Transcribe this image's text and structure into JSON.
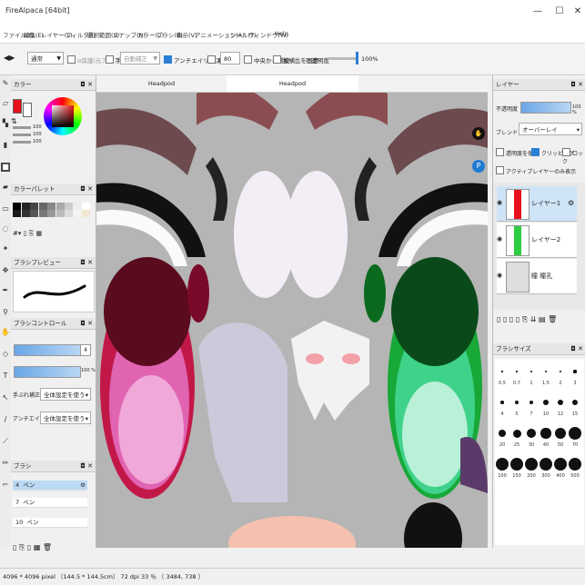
{
  "window": {
    "title": "FireAlpaca [64bit]",
    "minimize": "—",
    "maximize": "☐",
    "close": "✕"
  },
  "menu": [
    "ファイル(F)",
    "編集(E)",
    "レイヤー(L)",
    "フィルタ(I)",
    "選択範囲(S)",
    "スナップ(N)",
    "カラー(C)",
    "ブラシ(B)",
    "表示(V)",
    "アニメーション(A)",
    "ツール(T)",
    "ウィンドウ(W)",
    "Help"
  ],
  "tooloptions": {
    "mode_value": "通常",
    "protect_alpha": "α保護(元アルファ)",
    "hand_correction_label": "手ぶれ",
    "hand_correction_value": "自動補正",
    "antialias": "アンチエイリアス",
    "thickness_label": "丸め",
    "thickness_value": "80",
    "center_select": "中央から選択",
    "keep_ratio": "縦横比を固定",
    "opacity_label": "不透明度",
    "opacity_value": "100%",
    "opacity_fraction": 1.0
  },
  "tabs": [
    "Headpod",
    "Headpod"
  ],
  "panels": {
    "color": {
      "title": "カラー",
      "primary": "#e8101a",
      "values": [
        "100",
        "100",
        "100"
      ]
    },
    "palette": {
      "title": "カラーパレット",
      "swatches": [
        "#000000",
        "#222222",
        "#444444",
        "#666666",
        "#888888",
        "#aaaaaa",
        "#cccccc",
        "#eeeeee",
        "#ffffff",
        "#1a1a1a",
        "#333333",
        "#555555",
        "#777777",
        "#999999",
        "#bbbbbb",
        "#dddddd",
        "#f5f5f5",
        "#f0e8d0"
      ]
    },
    "brushpreview": {
      "title": "ブラシプレビュー"
    },
    "brushcontrol": {
      "title": "ブラシコントロール",
      "size_value": "4",
      "opacity_value": "100 %",
      "hand_label": "手ぶれ補正",
      "hand_value": "全体設定を使う",
      "aa_label": "アンチエイリアス",
      "aa_value": "全体設定を使う"
    },
    "brush": {
      "title": "ブラシ",
      "items": [
        {
          "size": "4",
          "name": "ペン"
        },
        {
          "size": "7",
          "name": "ペン"
        },
        {
          "size": "10",
          "name": "ペン"
        }
      ]
    },
    "layer": {
      "title": "レイヤー",
      "opacity_label": "不透明度",
      "opacity_value": "100 %",
      "blend_label": "ブレンド",
      "blend_value": "オーバーレイ",
      "protect": "透明度を保護",
      "clipping": "クリッピング",
      "lock": "ロック",
      "active_only": "アクティブレイヤーのみ表示",
      "layers": [
        {
          "name": "レイヤー1",
          "color": "#e8101a"
        },
        {
          "name": "レイヤー2",
          "color": "#2ecc40"
        },
        {
          "name": "瞳 瞳孔",
          "color": "#cccccc"
        }
      ]
    },
    "brushsize": {
      "title": "ブラシサイズ",
      "labels": [
        "0.5",
        "0.7",
        "1",
        "1.5",
        "2",
        "3",
        "4",
        "5",
        "7",
        "10",
        "12",
        "15",
        "20",
        "25",
        "30",
        "40",
        "50",
        "70",
        "100",
        "150",
        "200",
        "300",
        "400",
        "500"
      ]
    }
  },
  "status": "4096 * 4096 pixel （144.5 * 144.5cm） 72 dpi  33 ％  （ 3484, 738 ）"
}
